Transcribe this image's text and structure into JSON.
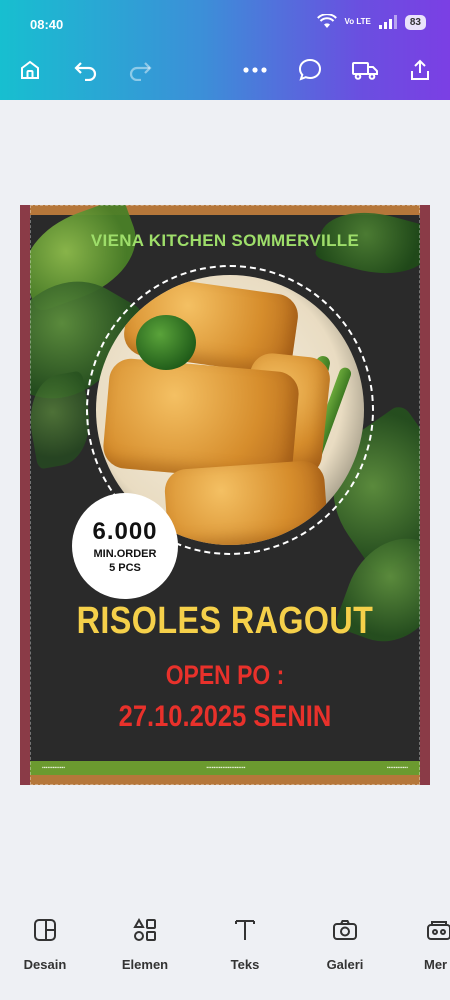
{
  "status_bar": {
    "time": "08:40",
    "network_label": "Vo LTE",
    "battery": "83"
  },
  "toolbar": {
    "icons": [
      "home-icon",
      "undo-icon",
      "redo-icon",
      "more-icon",
      "comment-icon",
      "truck-icon",
      "share-icon"
    ]
  },
  "design": {
    "brand": "VIENA KITCHEN SOMMERVILLE",
    "badge": {
      "price": "6.000",
      "min_order": "MIN.ORDER",
      "pcs": "5 PCS"
    },
    "headline": "RISOLES RAGOUT",
    "open_po": "OPEN PO :",
    "open_date": "27.10.2025 SENIN",
    "colors": {
      "background": "#2a2a2a",
      "frame": "#8a3b47",
      "brand": "#9ede6a",
      "headline": "#f5d04a",
      "accent_red": "#e8312b"
    }
  },
  "bottom_nav": {
    "items": [
      {
        "label": "Desain",
        "icon": "layout-icon"
      },
      {
        "label": "Elemen",
        "icon": "shapes-icon"
      },
      {
        "label": "Teks",
        "icon": "text-icon"
      },
      {
        "label": "Galeri",
        "icon": "camera-icon"
      },
      {
        "label": "Mer",
        "icon": "brand-icon"
      }
    ]
  }
}
